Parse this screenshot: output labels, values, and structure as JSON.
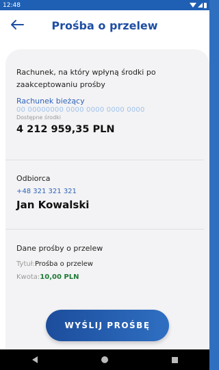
{
  "status_bar": {
    "time": "12:48"
  },
  "header": {
    "title": "Prośba o przelew"
  },
  "account_section": {
    "description": "Rachunek, na który wpłyną środki po zaakceptowaniu prośby",
    "account_name": "Rachunek bieżący",
    "account_number": "00 00000000 0000 0000 0000 0000",
    "available_label": "Dostępne środki",
    "available_amount": "4 212 959,35 PLN"
  },
  "recipient_section": {
    "label": "Odbiorca",
    "phone": "+48 321 321 321",
    "name": "Jan Kowalski"
  },
  "request_section": {
    "label": "Dane prośby o przelew",
    "title_key": "Tytuł:",
    "title_value": "Prośba o przelew",
    "amount_key": "Kwota:",
    "amount_value": "10,00 PLN"
  },
  "send_button": {
    "label": "WYŚLIJ PROŚBĘ"
  },
  "colors": {
    "brand_blue": "#2f6fc0",
    "title_blue": "#1f4ea3",
    "amount_green": "#1f7a36"
  }
}
